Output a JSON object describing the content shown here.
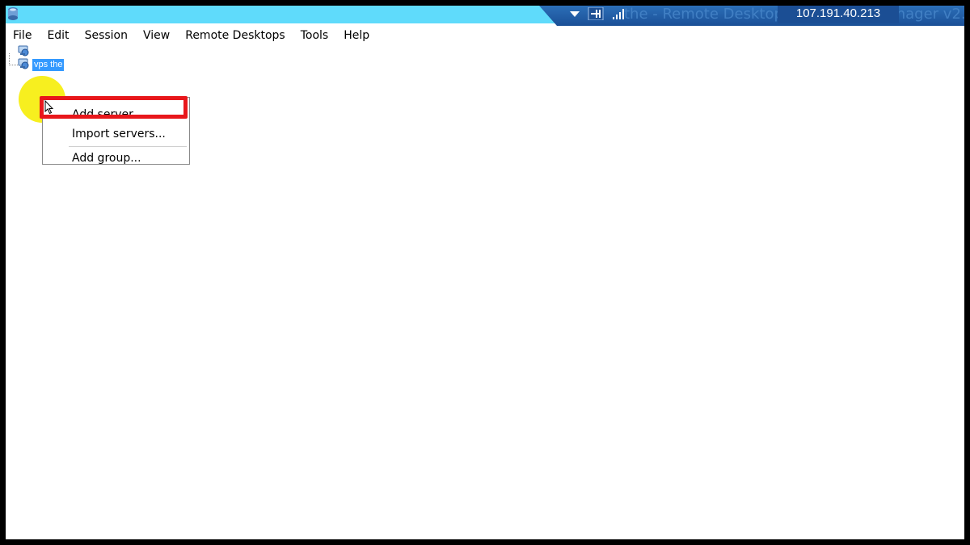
{
  "window": {
    "title_partial": "the - Remote Desktop Connection Manager v2.7",
    "remote_ip": "107.191.40.213"
  },
  "menubar": {
    "items": [
      "File",
      "Edit",
      "Session",
      "View",
      "Remote Desktops",
      "Tools",
      "Help"
    ]
  },
  "tree": {
    "group_label": "vps the"
  },
  "context_menu": {
    "items": [
      "Add server...",
      "Import servers...",
      "Add group..."
    ],
    "highlighted": "Add server..."
  },
  "colors": {
    "titlebar": "#5fdbfb",
    "connection_bar": "#1b4e94",
    "selection": "#3399ff",
    "highlight_box": "#e8171b",
    "cursor_halo": "#f7ef1f"
  },
  "icons": [
    "rdcman-app-icon",
    "pin-icon",
    "dropdown-arrow-icon",
    "signal-strength-icon",
    "server-group-icon",
    "mouse-pointer-icon"
  ]
}
